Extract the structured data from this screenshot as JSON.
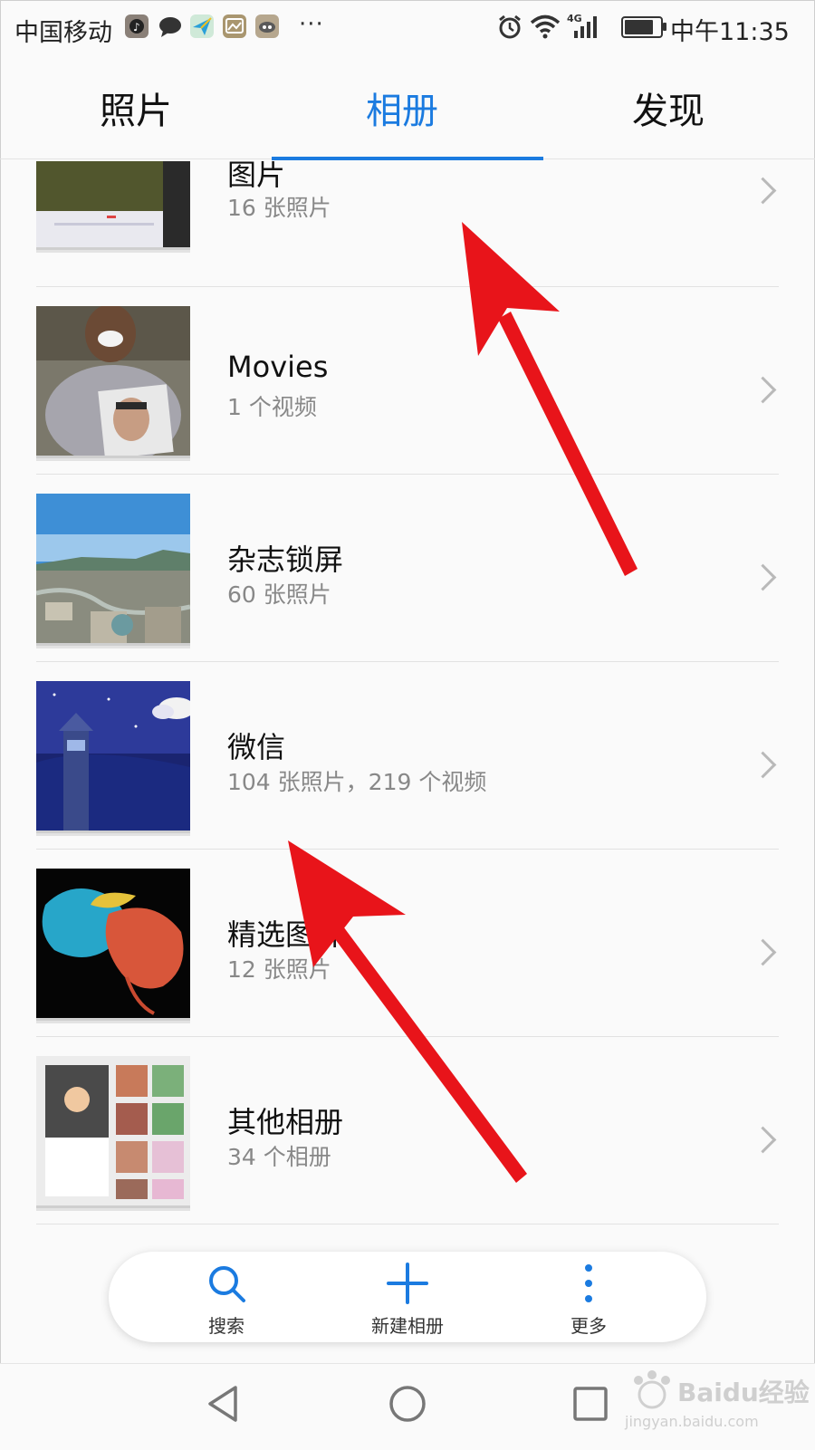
{
  "status_bar": {
    "carrier": "中国移动",
    "more_notifications": "···",
    "network": "4G",
    "time": "中午11:35",
    "battery_level": 0.85
  },
  "tabs": [
    {
      "label": "照片",
      "active": false
    },
    {
      "label": "相册",
      "active": true
    },
    {
      "label": "发现",
      "active": false
    }
  ],
  "albums": [
    {
      "title": "图片",
      "count": "16 张照片"
    },
    {
      "title": "Movies",
      "count": "1 个视频"
    },
    {
      "title": "杂志锁屏",
      "count": "60 张照片"
    },
    {
      "title": "微信",
      "count": "104 张照片，219 个视频"
    },
    {
      "title": "精选图片",
      "count": "12 张照片"
    },
    {
      "title": "其他相册",
      "count": "34 个相册"
    }
  ],
  "actions": {
    "search": "搜索",
    "new_album": "新建相册",
    "more": "更多"
  },
  "watermark": {
    "brand": "Baidu经验",
    "url": "jingyan.baidu.com"
  },
  "colors": {
    "accent": "#1b7be0",
    "annotation_arrow": "#e8141a"
  }
}
